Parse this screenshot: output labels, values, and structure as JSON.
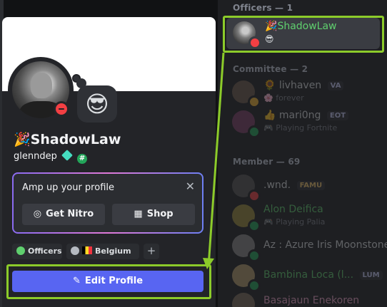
{
  "member_list": {
    "sections": [
      {
        "label": "Officers — 1"
      },
      {
        "label": "Committee — 2"
      },
      {
        "label": "Member — 69"
      }
    ],
    "officers": [
      {
        "emoji": "🎉",
        "name": "ShadowLaw",
        "name_color": "#5fcf6e",
        "sub_emoji": "😎"
      }
    ],
    "committee": [
      {
        "name": "livhaven",
        "name_prefix": "🌻",
        "tag": "VA",
        "sub": "forever",
        "sub_icon": "🌸"
      },
      {
        "name": "mari0ng",
        "name_prefix": "👍",
        "tag": "EOT",
        "sub": "Playing Fortnite",
        "sub_icon": "🎮"
      }
    ],
    "members": [
      {
        "name": ".wnd.",
        "tag": "FAMU"
      },
      {
        "name": "Alon Deifica",
        "sub": "Playing Palia",
        "sub_icon": "🎮"
      },
      {
        "name": "Az : Azure Iris Moonstone"
      },
      {
        "name": "Bambina Loca (l...",
        "tag": "LUM"
      },
      {
        "name": "Basajaun Enekoren"
      }
    ]
  },
  "profile": {
    "display_name_emoji": "🎉",
    "display_name": "ShadowLaw",
    "username": "glenndep",
    "status_emoji": "😎",
    "nitro_card": {
      "title": "Amp up your profile",
      "close": "✕",
      "get_nitro_label": "Get Nitro",
      "shop_label": "Shop"
    },
    "roles": [
      {
        "label": "Officers",
        "color": "#5fcf6e"
      },
      {
        "label": "Belgium",
        "color": "#b5bac1"
      }
    ],
    "add_role": "+",
    "edit_profile_label": "Edit Profile"
  },
  "colors": {
    "highlight": "#8ccb2a",
    "blurple": "#5865f2",
    "dnd": "#f23f43"
  }
}
